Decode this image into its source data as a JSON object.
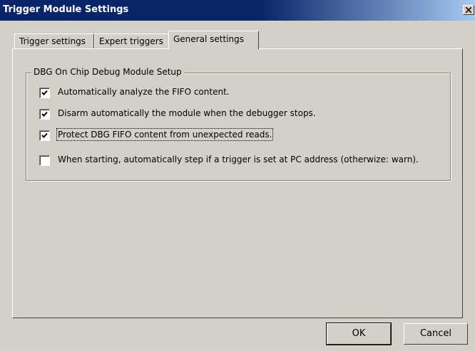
{
  "window": {
    "title": "Trigger Module Settings",
    "close_symbol": "×"
  },
  "tabs": [
    {
      "label": "Trigger settings",
      "active": false
    },
    {
      "label": "Expert triggers",
      "active": false
    },
    {
      "label": "General settings",
      "active": true
    }
  ],
  "group": {
    "label": "DBG On Chip Debug Module Setup",
    "options": [
      {
        "label": "Automatically analyze the FIFO content.",
        "checked": true
      },
      {
        "label": "Disarm automatically the module when the debugger stops.",
        "checked": true
      },
      {
        "label": "Protect DBG FIFO content from unexpected reads.",
        "checked": true
      },
      {
        "label": "When starting, automatically step if a trigger is set at PC address (otherwize: warn).",
        "checked": false
      }
    ]
  },
  "buttons": {
    "ok_label": "OK",
    "cancel_label": "Cancel"
  }
}
